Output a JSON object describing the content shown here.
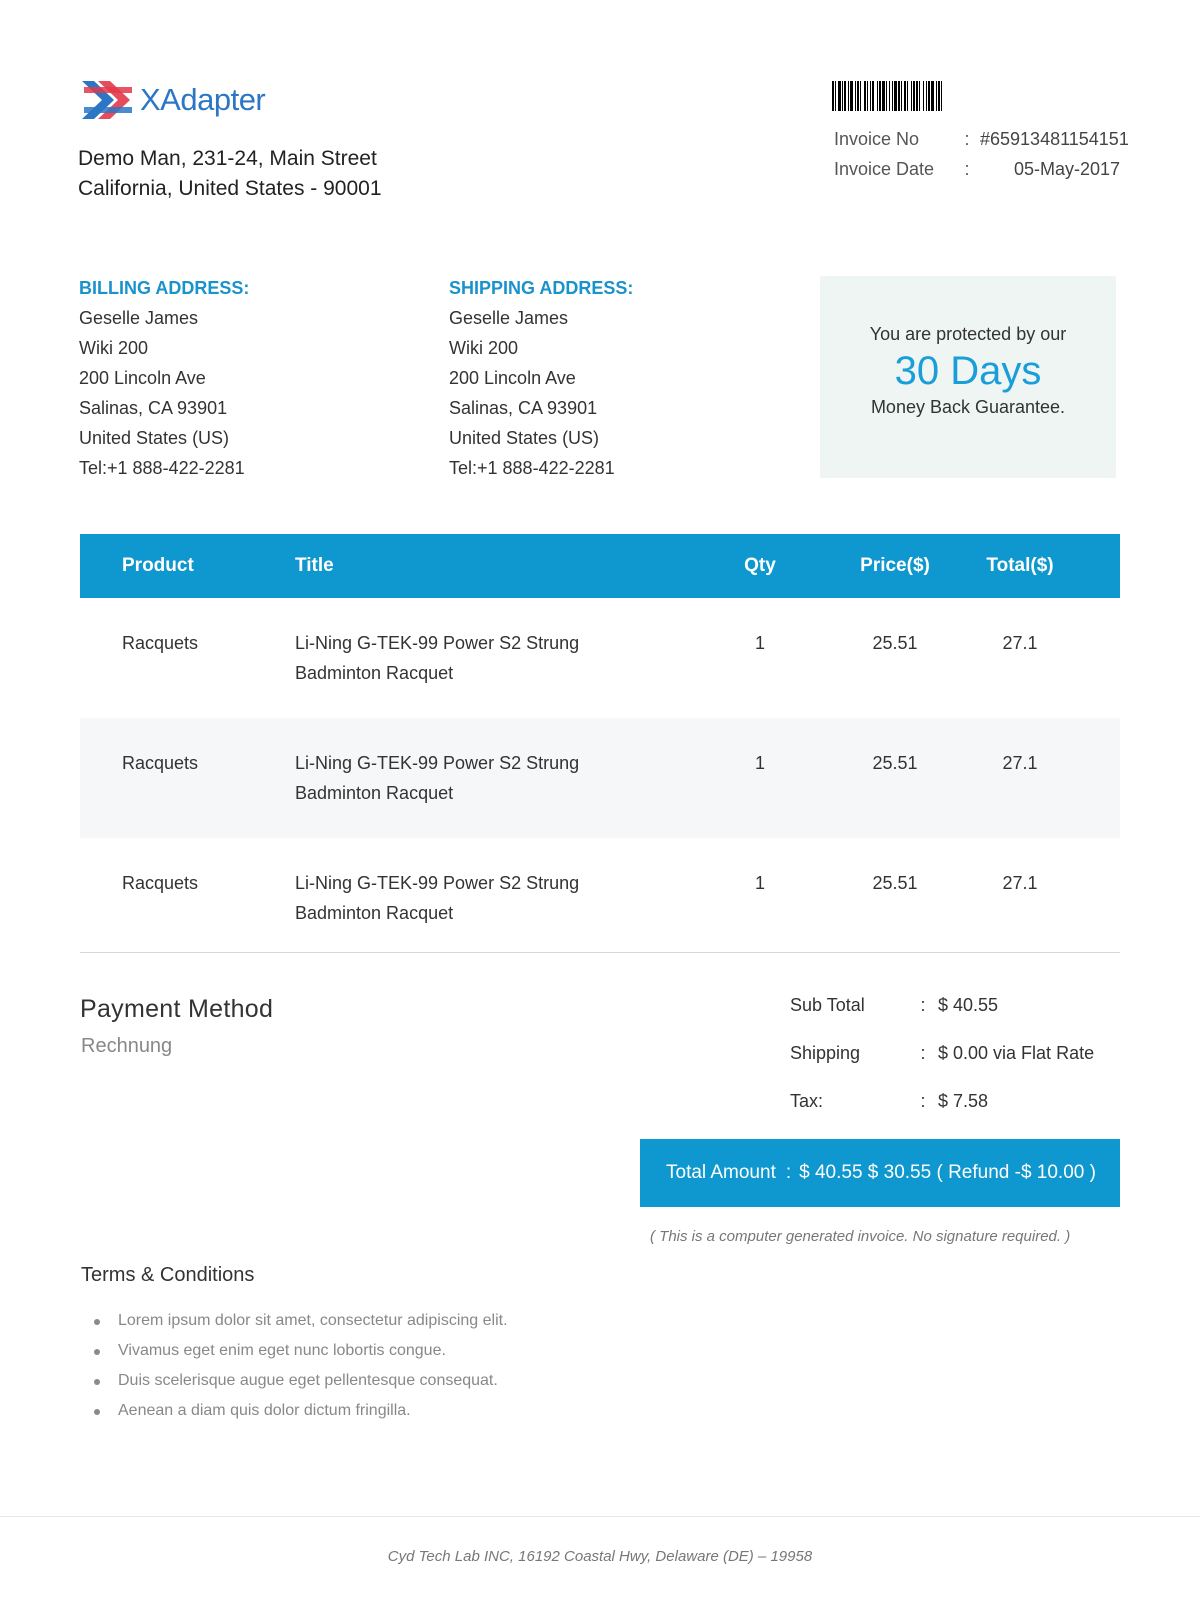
{
  "brand": {
    "name": "XAdapter",
    "colors": {
      "accent": "#0f98cf",
      "heading_blue": "#1a92cc",
      "logo_red": "#e23a4a",
      "logo_blue": "#2c77c5"
    }
  },
  "company": {
    "address_line1": "Demo Man, 231-24, Main Street",
    "address_line2": "California, United States - 90001"
  },
  "invoice": {
    "number_label": "Invoice No",
    "number_sep": ":",
    "number": "#65913481154151",
    "date_label": "Invoice Date",
    "date_sep": ":",
    "date": "05-May-2017"
  },
  "billing": {
    "title": "BILLING ADDRESS:",
    "lines": [
      "Geselle James",
      "Wiki 200",
      "200 Lincoln Ave",
      "Salinas, CA 93901",
      "United States (US)",
      "Tel:+1 888-422-2281"
    ]
  },
  "shipping": {
    "title": "SHIPPING ADDRESS:",
    "lines": [
      "Geselle James",
      "Wiki 200",
      "200 Lincoln Ave",
      "Salinas, CA 93901",
      "United States (US)",
      "Tel:+1 888-422-2281"
    ]
  },
  "guarantee": {
    "top": "You are protected by our",
    "days": "30 Days",
    "bottom": "Money Back Guarantee."
  },
  "table": {
    "headers": {
      "product": "Product",
      "title": "Title",
      "qty": "Qty",
      "price": "Price($)",
      "total": "Total($)"
    },
    "rows": [
      {
        "product": "Racquets",
        "title": "Li-Ning G-TEK-99 Power S2 Strung Badminton Racquet",
        "qty": "1",
        "price": "25.51",
        "total": "27.1"
      },
      {
        "product": "Racquets",
        "title": "Li-Ning G-TEK-99 Power S2 Strung Badminton Racquet",
        "qty": "1",
        "price": "25.51",
        "total": "27.1"
      },
      {
        "product": "Racquets",
        "title": "Li-Ning G-TEK-99 Power S2 Strung Badminton Racquet",
        "qty": "1",
        "price": "25.51",
        "total": "27.1"
      }
    ]
  },
  "payment": {
    "title": "Payment Method",
    "method": "Rechnung"
  },
  "totals": {
    "subtotal_label": "Sub Total",
    "subtotal": "$ 40.55",
    "shipping_label": "Shipping",
    "shipping": "$ 0.00 via Flat Rate",
    "tax_label": "Tax:",
    "tax": "$ 7.58",
    "sep": ":",
    "total_label": "Total Amount",
    "total": "$ 40.55 $ 30.55 ( Refund -$ 10.00 )",
    "note": "( This is a computer generated invoice. No signature required. )"
  },
  "terms": {
    "title": "Terms & Conditions",
    "items": [
      "Lorem ipsum dolor sit amet, consectetur adipiscing elit.",
      "Vivamus eget enim eget nunc lobortis congue.",
      "Duis scelerisque augue eget pellentesque consequat.",
      "Aenean a diam quis dolor dictum fringilla."
    ]
  },
  "footer": {
    "text": "Cyd Tech Lab INC, 16192 Coastal Hwy, Delaware (DE) – 19958"
  }
}
